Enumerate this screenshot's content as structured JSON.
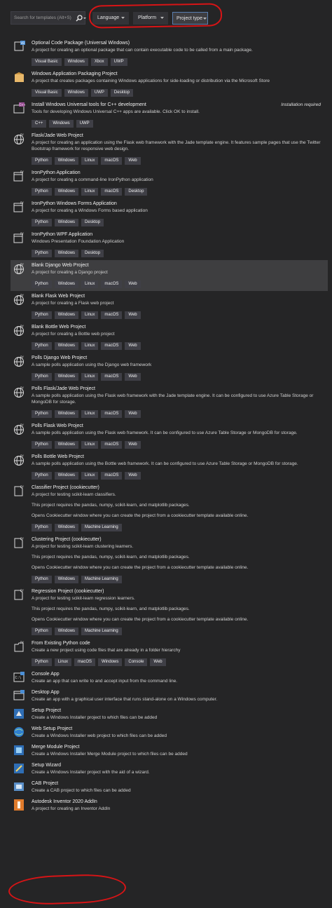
{
  "search": {
    "placeholder": "Search for templates (Alt+S)"
  },
  "filters": [
    {
      "label": "Language"
    },
    {
      "label": "Platform"
    },
    {
      "label": "Project type"
    }
  ],
  "colors": {
    "background": "#252526",
    "tag": "#3f3f46",
    "selected": "#3e3e40",
    "annotation": "#d81416",
    "accent": "#5a7fb0"
  },
  "templates": [
    {
      "name": "Optional Code Package (Universal Windows)",
      "desc": "A project for creating an optional package that can contain executable code to be called from a main package.",
      "tags": [
        "Visual Basic",
        "Windows",
        "Xbox",
        "UWP"
      ],
      "icon": "uwp-package-icon"
    },
    {
      "name": "Windows Application Packaging Project",
      "desc": "A project that creates packages containing Windows applications for side-loading or distribution via the Microsoft Store",
      "tags": [
        "Visual Basic",
        "Windows",
        "UWP",
        "Desktop"
      ],
      "icon": "packaging-icon"
    },
    {
      "name": "Install Windows Universal tools for C++ development",
      "desc": "Tools for developing Windows Universal C++ apps are available. Click OK to install.",
      "tags": [
        "C++",
        "Windows",
        "UWP"
      ],
      "icon": "cpp-uwp-icon",
      "note": "Installation required"
    },
    {
      "name": "Flask/Jade Web Project",
      "desc": "A project for creating an application using the Flask web framework with the Jade template engine. It features sample pages that use the Twitter Bootstrap framework for responsive web design.",
      "tags": [
        "Python",
        "Windows",
        "Linux",
        "macOS",
        "Web"
      ],
      "icon": "python-web-icon"
    },
    {
      "name": "IronPython Application",
      "desc": "A project for creating a command-line IronPython application",
      "tags": [
        "Python",
        "Windows",
        "Linux",
        "macOS",
        "Desktop"
      ],
      "icon": "python-app-icon"
    },
    {
      "name": "IronPython Windows Forms Application",
      "desc": "A project for creating a Windows Forms based application",
      "tags": [
        "Python",
        "Windows",
        "Desktop"
      ],
      "icon": "python-app-icon"
    },
    {
      "name": "IronPython WPF Application",
      "desc": "Windows Presentation Foundation Application",
      "tags": [
        "Python",
        "Windows",
        "Desktop"
      ],
      "icon": "python-app-icon"
    },
    {
      "name": "Blank Django Web Project",
      "desc": "A project for creating a Django project",
      "tags": [
        "Python",
        "Windows",
        "Linux",
        "macOS",
        "Web"
      ],
      "icon": "python-web-icon",
      "selected": true
    },
    {
      "name": "Blank Flask Web Project",
      "desc": "A project for creating a Flask web project",
      "tags": [
        "Python",
        "Windows",
        "Linux",
        "macOS",
        "Web"
      ],
      "icon": "python-web-icon"
    },
    {
      "name": "Blank Bottle Web Project",
      "desc": "A project for creating a Bottle web project",
      "tags": [
        "Python",
        "Windows",
        "Linux",
        "macOS",
        "Web"
      ],
      "icon": "python-web-icon"
    },
    {
      "name": "Polls Django Web Project",
      "desc": "A sample polls application using the Django web framework",
      "tags": [
        "Python",
        "Windows",
        "Linux",
        "macOS",
        "Web"
      ],
      "icon": "python-web-icon"
    },
    {
      "name": "Polls Flask/Jade Web Project",
      "desc": "A sample polls application using the Flask web framework with the Jade template engine. It can be configured to use Azure Table Storage or MongoDB for storage.",
      "tags": [
        "Python",
        "Windows",
        "Linux",
        "macOS",
        "Web"
      ],
      "icon": "python-web-icon"
    },
    {
      "name": "Polls Flask Web Project",
      "desc": "A sample polls application using the Flask web framework. It can be configured to use Azure Table Storage or MongoDB for storage.",
      "tags": [
        "Python",
        "Windows",
        "Linux",
        "macOS",
        "Web"
      ],
      "icon": "python-web-icon"
    },
    {
      "name": "Polls Bottle Web Project",
      "desc": "A sample polls application using the Bottle web framework. It can be configured to use Azure Table Storage or MongoDB for storage.",
      "tags": [
        "Python",
        "Windows",
        "Linux",
        "macOS",
        "Web"
      ],
      "icon": "python-web-icon"
    },
    {
      "name": "Classifier Project (cookiecutter)",
      "desc": "A project for testing scikit-learn classifiers.",
      "notes": [
        "This project requires the pandas, numpy, scikit-learn, and matplotlib packages.",
        "Opens Cookiecutter window where you can create the project from a cookiecutter template available online."
      ],
      "tags": [
        "Python",
        "Windows",
        "Machine Learning"
      ],
      "icon": "python-ml-icon"
    },
    {
      "name": "Clustering Project (cookiecutter)",
      "desc": "A project for testing scikit-learn clustering learners.",
      "notes": [
        "This project requires the pandas, numpy, scikit-learn, and matplotlib packages.",
        "Opens Cookiecutter window where you can create the project from a cookiecutter template available online."
      ],
      "tags": [
        "Python",
        "Windows",
        "Machine Learning"
      ],
      "icon": "python-ml-icon"
    },
    {
      "name": "Regression Project (cookiecutter)",
      "desc": "A project for testing scikit-learn regression learners.",
      "notes": [
        "This project requires the pandas, numpy, scikit-learn, and matplotlib packages.",
        "Opens Cookiecutter window where you can create the project from a cookiecutter template available online."
      ],
      "tags": [
        "Python",
        "Windows",
        "Machine Learning"
      ],
      "icon": "python-ml-icon"
    },
    {
      "name": "From Existing Python code",
      "desc": "Create a new project using code files that are already in a folder hierarchy",
      "tags": [
        "Python",
        "Linux",
        "macOS",
        "Windows",
        "Console",
        "Web"
      ],
      "icon": "python-existing-icon"
    },
    {
      "name": "Console App",
      "desc": "Create an app that can write to and accept input from the command line.",
      "tags": [],
      "icon": "console-app-icon"
    },
    {
      "name": "Desktop App",
      "desc": "Create an app with a graphical user interface that runs stand-alone on a Windows computer.",
      "tags": [],
      "icon": "desktop-app-icon"
    },
    {
      "name": "Setup Project",
      "desc": "Create a Windows Installer project to which files can be added",
      "tags": [],
      "icon": "setup-project-icon"
    },
    {
      "name": "Web Setup Project",
      "desc": "Create a Windows Installer web project to which files can be added",
      "tags": [],
      "icon": "web-setup-icon"
    },
    {
      "name": "Merge Module Project",
      "desc": "Create a Windows Installer Merge Module project to which files can be added",
      "tags": [],
      "icon": "merge-module-icon"
    },
    {
      "name": "Setup Wizard",
      "desc": "Create a Windows Installer project with the aid of a wizard.",
      "tags": [],
      "icon": "setup-wizard-icon"
    },
    {
      "name": "CAB Project",
      "desc": "Create a CAB project to which files can be added",
      "tags": [],
      "icon": "cab-project-icon"
    },
    {
      "name": "Autodesk Inventor 2020 AddIn",
      "desc": "A project for creating an Inventor AddIn",
      "tags": [],
      "icon": "inventor-addin-icon"
    }
  ]
}
